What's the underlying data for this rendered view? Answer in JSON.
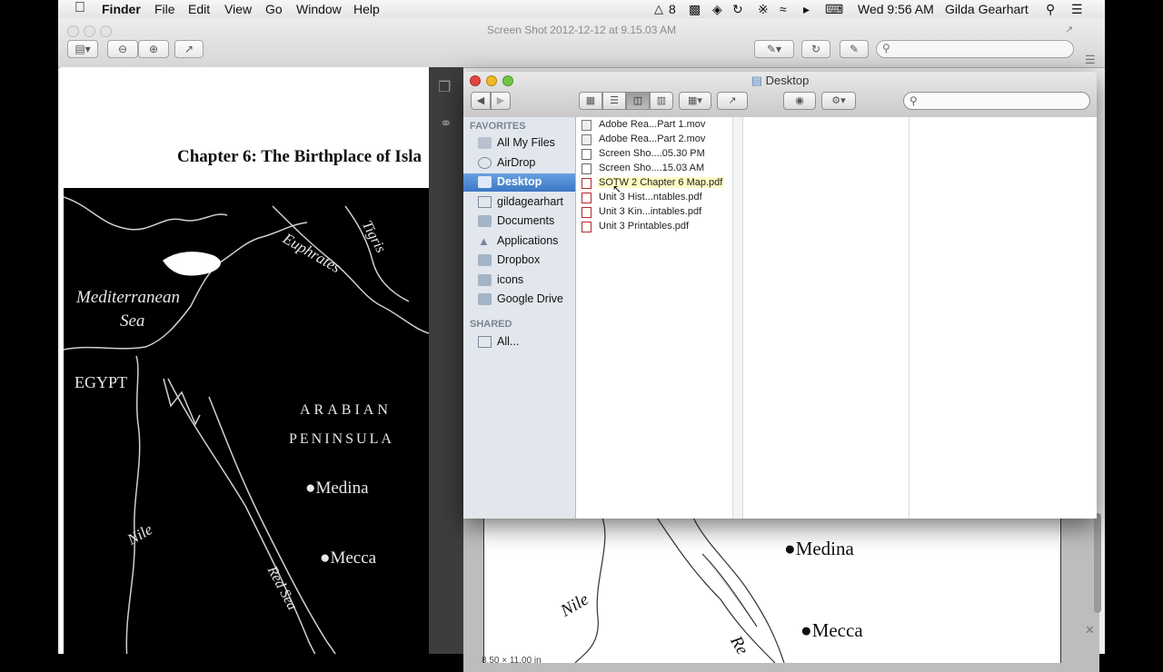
{
  "menubar": {
    "app_name": "Finder",
    "items": [
      "File",
      "Edit",
      "View",
      "Go",
      "Window",
      "Help"
    ],
    "status_count": "8",
    "clock": "Wed 9:56 AM",
    "user": "Gilda Gearhart"
  },
  "preview": {
    "title": "Screen Shot 2012-12-12 at 9.15.03 AM",
    "chapter_title": "Chapter 6: The Birthplace of Isla",
    "map_labels": {
      "tigris": "Tigris",
      "euphrates": "Euphrates",
      "med_sea_1": "Mediterranean",
      "med_sea_2": "Sea",
      "egypt": "EGYPT",
      "arabian": "ARABIAN",
      "peninsula": "PENINSULA",
      "medina": "Medina",
      "mecca": "Mecca",
      "nile": "Nile",
      "red_sea": "Red Sea"
    },
    "right_labels": {
      "medina": "Medina",
      "mecca": "Mecca",
      "nile": "Nile",
      "red": "Re",
      "page_size": "8.50 × 11.00 in"
    }
  },
  "finder": {
    "title": "Desktop",
    "favorites_header": "FAVORITES",
    "favorites": [
      {
        "label": "All My Files",
        "icon": "all-files-icon"
      },
      {
        "label": "AirDrop",
        "icon": "airdrop-icon"
      },
      {
        "label": "Desktop",
        "icon": "desktop-icon",
        "selected": true
      },
      {
        "label": "gildagearhart",
        "icon": "home-icon"
      },
      {
        "label": "Documents",
        "icon": "documents-icon"
      },
      {
        "label": "Applications",
        "icon": "applications-icon"
      },
      {
        "label": "Dropbox",
        "icon": "folder-icon"
      },
      {
        "label": "icons",
        "icon": "folder-icon"
      },
      {
        "label": "Google Drive",
        "icon": "folder-icon"
      }
    ],
    "shared_header": "SHARED",
    "shared": [
      {
        "label": "All...",
        "icon": "network-icon"
      }
    ],
    "files": [
      {
        "name": "Adobe Rea...Part 1.mov",
        "kind": "mov"
      },
      {
        "name": "Adobe Rea...Part 2.mov",
        "kind": "mov"
      },
      {
        "name": "Screen Sho....05.30 PM",
        "kind": "img"
      },
      {
        "name": "Screen Sho....15.03 AM",
        "kind": "img"
      },
      {
        "name": "SOTW 2 Chapter 6 Map.pdf",
        "kind": "pdf",
        "highlighted": true
      },
      {
        "name": "Unit 3 Hist...ntables.pdf",
        "kind": "pdf"
      },
      {
        "name": "Unit 3 Kin...intables.pdf",
        "kind": "pdf"
      },
      {
        "name": "Unit 3 Printables.pdf",
        "kind": "pdf"
      }
    ]
  },
  "colors": {
    "selection": "#3d76c4",
    "sidebar_bg": "#e2e7ed",
    "highlight": "#fefcc4"
  }
}
